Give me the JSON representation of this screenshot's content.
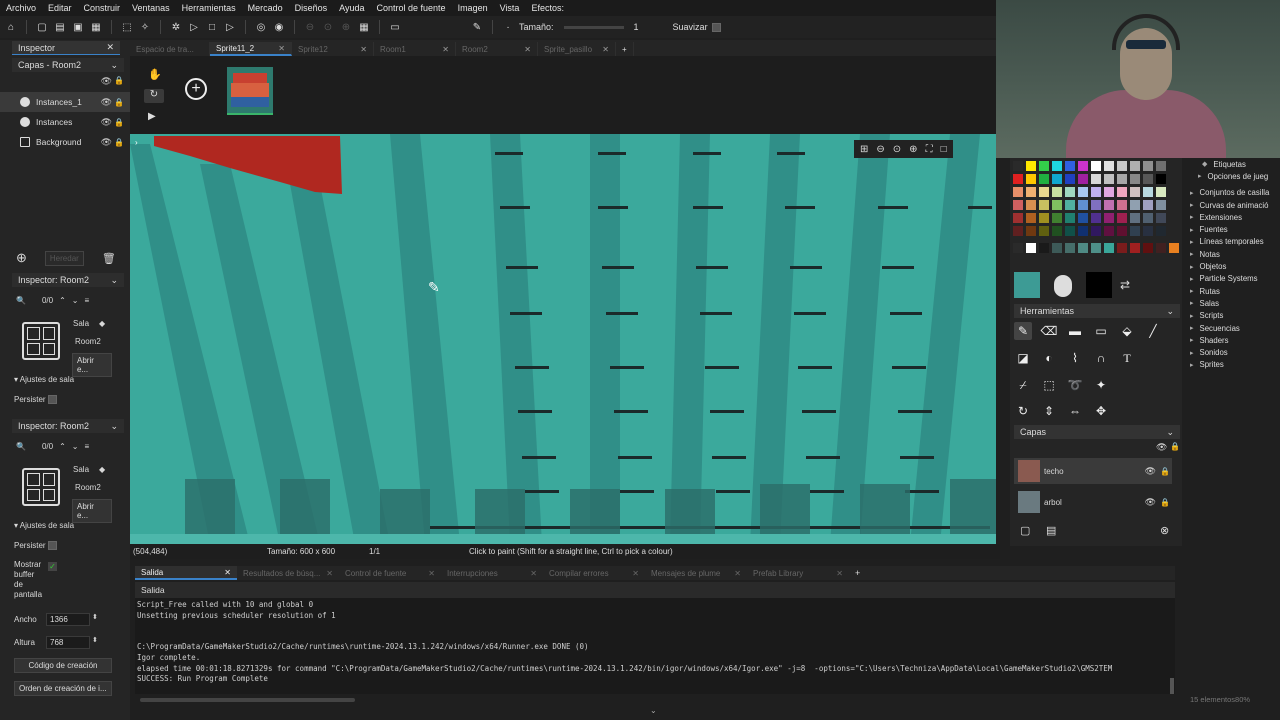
{
  "menu": [
    "Archivo",
    "Editar",
    "Construir",
    "Ventanas",
    "Herramientas",
    "Mercado",
    "Diseños",
    "Ayuda",
    "Control de fuente",
    "Imagen",
    "Vista",
    "Efectos:"
  ],
  "toolbar": {
    "size_label": "Tamaño:",
    "size_value": "1",
    "smooth_label": "Suavizar"
  },
  "inspector": {
    "tab_label": "Inspector",
    "layers_title": "Capas - Room2",
    "layers": [
      "Instances_1",
      "Instances",
      "Background"
    ],
    "inherit_label": "Heredar",
    "room_inspector_title": "Inspector: Room2",
    "counter": "0/0",
    "sala_label": "Sala",
    "room_name": "Room2",
    "open_label": "Abrir e...",
    "room_settings": "Ajustes de sala",
    "persist_label": "Persister",
    "room_inspector_title2": "Inspector: Room2",
    "counter2": "0/0",
    "sala_label2": "Sala",
    "room_name2": "Room2",
    "open_label2": "Abrir e...",
    "room_settings2": "Ajustes de sala",
    "persist_label2": "Persister",
    "show_buffer_label": [
      "Mostrar",
      "buffer",
      "de",
      "pantalla"
    ],
    "width_label": "Ancho",
    "width_value": "1366",
    "height_label": "Altura",
    "height_value": "768",
    "creation_code_button": "Código de creación",
    "creation_order_button": "Orden de creación de i..."
  },
  "tabs": [
    {
      "label": "Espacio de tra...",
      "active": false
    },
    {
      "label": "Sprite11_2",
      "active": true
    },
    {
      "label": "Sprite12",
      "active": false
    },
    {
      "label": "Room1",
      "active": false
    },
    {
      "label": "Room2",
      "active": false
    },
    {
      "label": "Sprite_pasillo",
      "active": false
    }
  ],
  "status": {
    "coords": "(504,484)",
    "size": "Tamaño: 600 x 600",
    "frame": "1/1",
    "hint": "Click to paint (Shift for a straight line, Ctrl to pick a colour)"
  },
  "output": {
    "tabs": [
      "Salida",
      "Resultados de búsq...",
      "Control de fuente",
      "Interrupciones",
      "Compilar errores",
      "Mensajes de plume",
      "Prefab Library"
    ],
    "title": "Salida",
    "lines": [
      "Script_Free called with 10 and global 0",
      "Unsetting previous scheduler resolution of 1",
      "",
      "",
      "C:\\ProgramData/GameMakerStudio2/Cache/runtimes\\runtime-2024.13.1.242/windows/x64/Runner.exe DONE (0)",
      "Igor complete.",
      "elapsed time 00:01:18.8271329s for command \"C:\\ProgramData/GameMakerStudio2/Cache/runtimes\\runtime-2024.13.1.242/bin/igor/windows/x64/Igor.exe\" -j=8  -options=\"C:\\Users\\Techniza\\AppData\\Local\\GameMakerStudio2\\GMS2TEM",
      "SUCCESS: Run Program Complete"
    ]
  },
  "right": {
    "tools_title": "Herramientas",
    "layers_title": "Capas",
    "layers": [
      "techo",
      "arbol"
    ],
    "palette": [
      "#2a2a2a",
      "#ffe800",
      "#33d04a",
      "#1fd6e0",
      "#3060e0",
      "#cc33cc",
      "#ffffff",
      "#e0e0e0",
      "#c8c8c8",
      "#b0b0b0",
      "#909090",
      "#707070",
      "#e02020",
      "#ffc800",
      "#20b040",
      "#10a8d0",
      "#2040c0",
      "#a020a0",
      "#d8d8d8",
      "#c0c0c0",
      "#a8a8a8",
      "#888888",
      "#585858",
      "#000000",
      "#e8906a",
      "#f0b070",
      "#e8d890",
      "#c8e0a0",
      "#a0d8c0",
      "#a8c8f0",
      "#c0b0f0",
      "#e0a8e0",
      "#f0a8c0",
      "#d0c0c0",
      "#b8d8e0",
      "#d8e8c0",
      "#d06060",
      "#d89050",
      "#c8c060",
      "#80c060",
      "#50b0a0",
      "#6090d0",
      "#8070c0",
      "#c070b0",
      "#d07090",
      "#90a0b0",
      "#a0a0c0",
      "#8090a0",
      "#a03030",
      "#b06020",
      "#a09020",
      "#408030",
      "#208070",
      "#2050a0",
      "#503090",
      "#902070",
      "#a02050",
      "#607080",
      "#506070",
      "#404858",
      "#602020",
      "#703810",
      "#606010",
      "#205020",
      "#105048",
      "#103070",
      "#301860",
      "#601040",
      "#601030",
      "#304050",
      "#283040",
      "#202830"
    ],
    "palette_bottom": [
      "#2a2a2a",
      "#ffffff",
      "#1a1a1a",
      "#3d5a58",
      "#466e6a",
      "#4f8a84",
      "#4e8f88",
      "#3aa79a",
      "#7a1c1c",
      "#a02020",
      "#601010",
      "#402020",
      "#e88020"
    ],
    "primary_color": "#3d9b95",
    "secondary_color": "#000000"
  },
  "assets": {
    "items": [
      "Etiquetas",
      "Opciones de jueg",
      "Conjuntos de casilla",
      "Curvas de animació",
      "Extensiones",
      "Fuentes",
      "Líneas temporales",
      "Notas",
      "Objetos",
      "Particle Systems",
      "Rutas",
      "Salas",
      "Scripts",
      "Secuencias",
      "Shaders",
      "Sonidos",
      "Sprites"
    ],
    "footer": "15 elementos",
    "zoom": "80%"
  }
}
